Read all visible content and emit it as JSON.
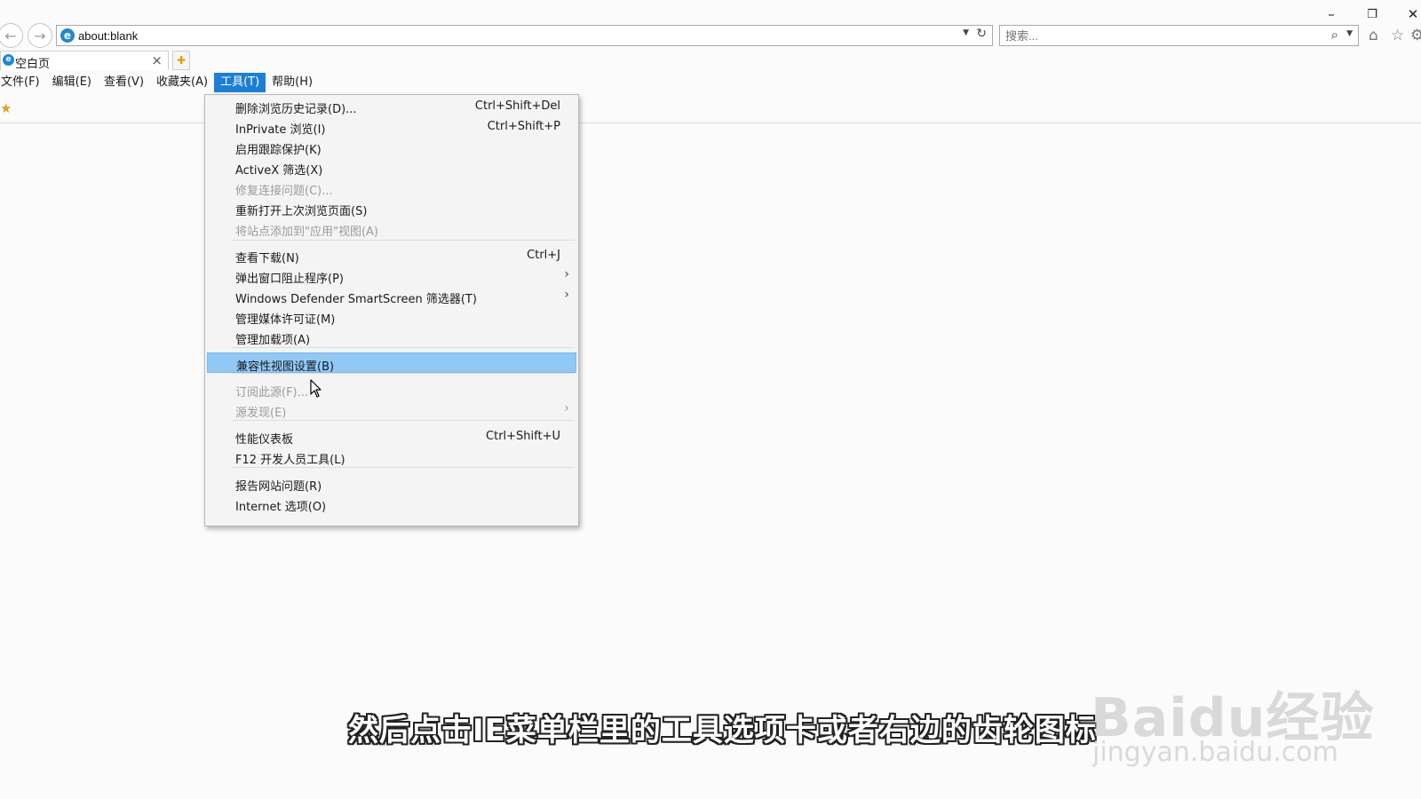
{
  "window": {
    "minimize_icon": "–",
    "restore_icon": "❐",
    "close_icon": "✕"
  },
  "nav": {
    "back_icon": "←",
    "forward_icon": "→"
  },
  "address_bar": {
    "value": "about:blank"
  },
  "search_box": {
    "placeholder": "搜索..."
  },
  "tab": {
    "label": "空白页"
  },
  "menubar": {
    "items": [
      "文件(F)",
      "编辑(E)",
      "查看(V)",
      "收藏夹(A)",
      "工具(T)",
      "帮助(H)"
    ],
    "active": "工具(T)"
  },
  "tools_menu": {
    "items": [
      {
        "label": "删除浏览历史记录(D)...",
        "shortcut": "Ctrl+Shift+Del"
      },
      {
        "label": "InPrivate 浏览(I)",
        "shortcut": "Ctrl+Shift+P"
      },
      {
        "label": "启用跟踪保护(K)",
        "shortcut": ""
      },
      {
        "label": "ActiveX 筛选(X)",
        "shortcut": ""
      },
      {
        "label": "修复连接问题(C)...",
        "shortcut": "",
        "disabled": true
      },
      {
        "label": "重新打开上次浏览页面(S)",
        "shortcut": ""
      },
      {
        "label": "将站点添加到\"应用\"视图(A)",
        "shortcut": "",
        "disabled": true
      },
      {
        "label": "查看下载(N)",
        "shortcut": "Ctrl+J"
      },
      {
        "label": "弹出窗口阻止程序(P)",
        "shortcut": "",
        "submenu": true
      },
      {
        "label": "Windows Defender SmartScreen 筛选器(T)",
        "shortcut": "",
        "submenu": true
      },
      {
        "label": "管理媒体许可证(M)",
        "shortcut": ""
      },
      {
        "label": "管理加载项(A)",
        "shortcut": ""
      },
      {
        "label": "兼容性视图设置(B)",
        "shortcut": "",
        "highlighted": true
      },
      {
        "label": "订阅此源(F)...",
        "shortcut": "",
        "disabled": true
      },
      {
        "label": "源发现(E)",
        "shortcut": "",
        "disabled": true,
        "submenu": true
      },
      {
        "label": "性能仪表板",
        "shortcut": "Ctrl+Shift+U"
      },
      {
        "label": "F12 开发人员工具(L)",
        "shortcut": ""
      },
      {
        "label": "报告网站问题(R)",
        "shortcut": ""
      },
      {
        "label": "Internet 选项(O)",
        "shortcut": ""
      }
    ]
  },
  "subtitle": "然后点击IE菜单栏里的工具选项卡或者右边的齿轮图标",
  "watermark": {
    "logo": "Baidu经验",
    "url": "jingyan.baidu.com"
  },
  "colors": {
    "menu_active": "#1b7fd6",
    "menu_highlight": "#90c8f6",
    "disabled_text": "#9b9b9b"
  }
}
